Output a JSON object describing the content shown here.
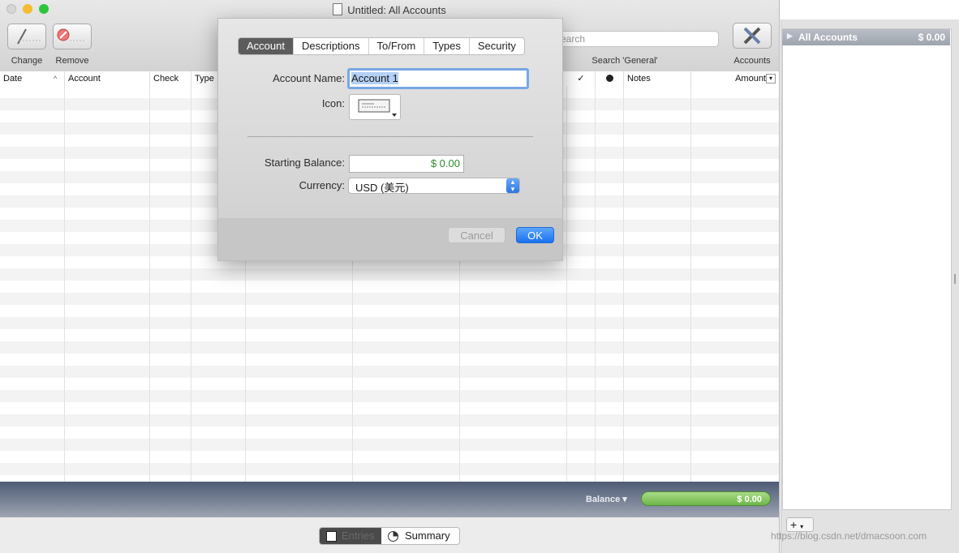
{
  "window": {
    "title": "Untitled:  All Accounts"
  },
  "toolbar": {
    "change_label": "Change",
    "remove_label": "Remove",
    "search_placeholder": "earch",
    "search_label": "Search 'General'",
    "accounts_label": "Accounts"
  },
  "table": {
    "columns": [
      "Date",
      "Account",
      "Check",
      "Type",
      "✓",
      "Notes",
      "Amount"
    ]
  },
  "footer": {
    "balance_label": "Balance ▾",
    "balance_value": "$ 0.00",
    "segments": [
      "Entries",
      "Summary"
    ]
  },
  "sidebar": {
    "items": [
      {
        "label": "All Accounts",
        "value": "$ 0.00"
      }
    ]
  },
  "dialog": {
    "tabs": [
      "Account",
      "Descriptions",
      "To/From",
      "Types",
      "Security"
    ],
    "active_tab": "Account",
    "account_name_label": "Account Name:",
    "account_name_value": "Account 1",
    "icon_label": "Icon:",
    "starting_balance_label": "Starting Balance:",
    "starting_balance_value": "$ 0.00",
    "currency_label": "Currency:",
    "currency_value": "USD (美元)",
    "cancel_label": "Cancel",
    "ok_label": "OK"
  },
  "watermark": {
    "text": "https://blog.csdn.net/dmacsoon.com"
  },
  "colors": {
    "accent": "#1a72ef",
    "balance_green": "#6db64a",
    "footer_bar": "#4f5c74",
    "positive_value": "#2e8b2e"
  }
}
